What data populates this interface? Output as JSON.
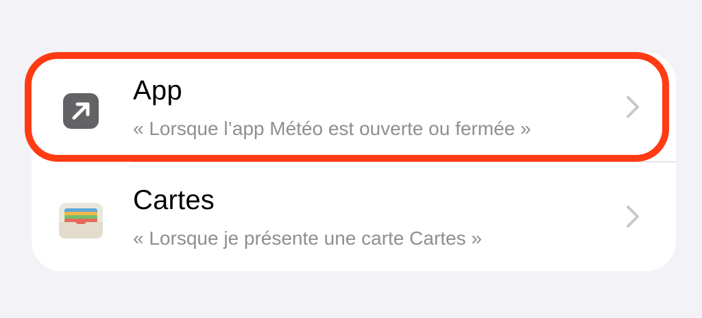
{
  "rows": [
    {
      "title": "App",
      "subtitle": "« Lorsque l’app Météo est ouverte ou fermée »",
      "icon": "arrow-up-right-icon",
      "icon_color": "#636366"
    },
    {
      "title": "Cartes",
      "subtitle": "« Lorsque je présente une carte Cartes »",
      "icon": "wallet-icon",
      "icon_color": "#ece7dc"
    }
  ],
  "highlight_color": "#ff3b14"
}
